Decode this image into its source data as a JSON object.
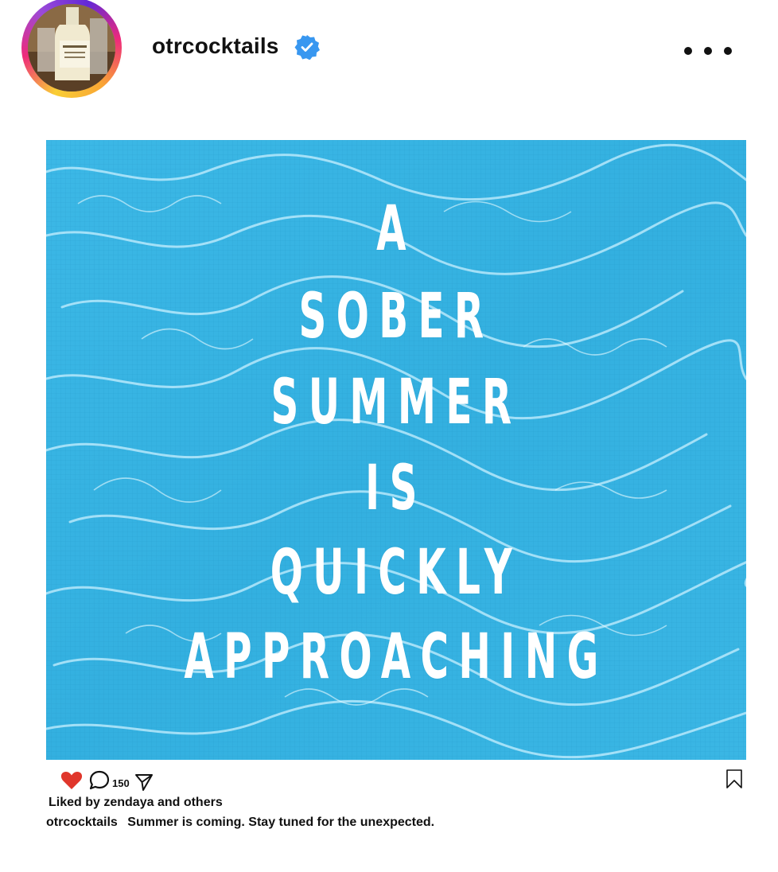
{
  "post": {
    "username": "otrcocktails",
    "headline_lines": [
      "A",
      "SOBER",
      "SUMMER",
      "IS",
      "QUICKLY",
      "APPROACHING"
    ],
    "comment_count": "150",
    "liked_by_text": "Liked by zendaya and others",
    "caption_user": "otrcocktails",
    "caption_text": "Summer is coming. Stay tuned for the unexpected."
  },
  "colors": {
    "verified": "#3897f0",
    "like_heart": "#e0362b",
    "water": "#38b6e3"
  },
  "icons": {
    "avatar": "bottle-photo",
    "verified": "verified-badge-icon",
    "more": "more-options-icon",
    "like": "heart-icon",
    "comment": "comment-icon",
    "share": "send-icon",
    "save": "bookmark-icon"
  }
}
